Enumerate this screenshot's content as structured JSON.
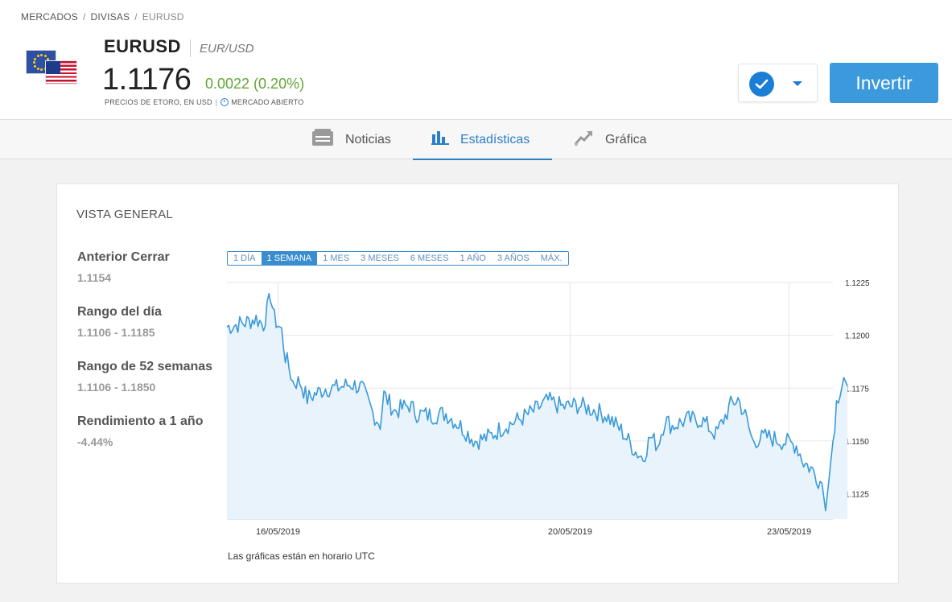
{
  "breadcrumb": [
    "MERCADOS",
    "DIVISAS",
    "EURUSD"
  ],
  "instrument": {
    "symbol": "EURUSD",
    "pair": "EUR/USD",
    "price": "1.1176",
    "change": "0.0022 (0.20%)",
    "prices_note": "PRECIOS DE ETORO, EN USD",
    "market_status": "MERCADO ABIERTO"
  },
  "actions": {
    "invest_label": "Invertir"
  },
  "tabs": [
    {
      "label": "Noticias",
      "icon": "news-icon",
      "active": false
    },
    {
      "label": "Estadísticas",
      "icon": "bar-chart-icon",
      "active": true
    },
    {
      "label": "Gráfica",
      "icon": "chart-trend-icon",
      "active": false
    }
  ],
  "overview": {
    "title": "VISTA GENERAL",
    "stats": [
      {
        "label": "Anterior Cerrar",
        "value": "1.1154"
      },
      {
        "label": "Rango del día",
        "value": "1.1106 - 1.1185"
      },
      {
        "label": "Rango de 52 semanas",
        "value": "1.1106 - 1.1850"
      },
      {
        "label": "Rendimiento a 1 año",
        "value": "-4.44%"
      }
    ],
    "ranges": [
      "1 DÍA",
      "1 SEMANA",
      "1 MES",
      "3 MESES",
      "6 MESES",
      "1 AÑO",
      "3 AÑOS",
      "MÁX."
    ],
    "active_range": "1 SEMANA",
    "note": "Las gráficas están en horario UTC"
  },
  "colors": {
    "accent": "#3c99dc",
    "positive": "#5fa634",
    "line": "#3a9ad9",
    "area": "#e8f3fb"
  },
  "chart_data": {
    "type": "area",
    "title": "",
    "xlabel": "",
    "ylabel": "",
    "x_start": "15/05/2019",
    "x_end": "23/05/2019",
    "x_ticks": [
      {
        "value": 0.7,
        "label": "16/05/2019"
      },
      {
        "value": 4.7,
        "label": "20/05/2019"
      },
      {
        "value": 7.7,
        "label": "23/05/2019"
      }
    ],
    "x_range": [
      0,
      8.3
    ],
    "y_ticks": [
      1.1225,
      1.12,
      1.1175,
      1.115,
      1.1125
    ],
    "ylim": [
      1.1113,
      1.1225
    ],
    "y_axis_position": "right",
    "grid": true,
    "points": [
      [
        0.0,
        1.1204
      ],
      [
        0.25,
        1.1206
      ],
      [
        0.4,
        1.1208
      ],
      [
        0.5,
        1.1205
      ],
      [
        0.6,
        1.1219
      ],
      [
        0.65,
        1.1208
      ],
      [
        0.75,
        1.1202
      ],
      [
        0.8,
        1.119
      ],
      [
        0.85,
        1.1185
      ],
      [
        0.9,
        1.1178
      ],
      [
        1.0,
        1.1178
      ],
      [
        1.1,
        1.117
      ],
      [
        1.2,
        1.1172
      ],
      [
        1.35,
        1.1175
      ],
      [
        1.5,
        1.1175
      ],
      [
        1.7,
        1.1177
      ],
      [
        1.85,
        1.1175
      ],
      [
        2.0,
        1.1163
      ],
      [
        2.1,
        1.1158
      ],
      [
        2.15,
        1.1172
      ],
      [
        2.3,
        1.1164
      ],
      [
        2.5,
        1.1167
      ],
      [
        2.6,
        1.1163
      ],
      [
        2.8,
        1.1162
      ],
      [
        3.0,
        1.1163
      ],
      [
        3.2,
        1.1157
      ],
      [
        3.4,
        1.115
      ],
      [
        3.6,
        1.1152
      ],
      [
        3.8,
        1.1157
      ],
      [
        4.0,
        1.116
      ],
      [
        4.2,
        1.1164
      ],
      [
        4.4,
        1.1169
      ],
      [
        4.6,
        1.1166
      ],
      [
        4.8,
        1.1167
      ],
      [
        5.0,
        1.1165
      ],
      [
        5.2,
        1.1162
      ],
      [
        5.4,
        1.1155
      ],
      [
        5.6,
        1.1145
      ],
      [
        5.7,
        1.1142
      ],
      [
        5.8,
        1.1152
      ],
      [
        5.9,
        1.1148
      ],
      [
        6.0,
        1.116
      ],
      [
        6.1,
        1.1157
      ],
      [
        6.3,
        1.116
      ],
      [
        6.5,
        1.116
      ],
      [
        6.7,
        1.1153
      ],
      [
        6.9,
        1.1167
      ],
      [
        7.0,
        1.117
      ],
      [
        7.1,
        1.1162
      ],
      [
        7.2,
        1.115
      ],
      [
        7.4,
        1.1152
      ],
      [
        7.6,
        1.115
      ],
      [
        7.8,
        1.1148
      ],
      [
        7.9,
        1.114
      ],
      [
        8.0,
        1.1137
      ],
      [
        8.1,
        1.1132
      ],
      [
        8.15,
        1.113
      ],
      [
        8.2,
        1.1117
      ],
      [
        8.25,
        1.1133
      ],
      [
        8.3,
        1.115
      ],
      [
        8.35,
        1.1168
      ],
      [
        8.4,
        1.1175
      ],
      [
        8.45,
        1.118
      ],
      [
        8.5,
        1.1176
      ]
    ]
  }
}
